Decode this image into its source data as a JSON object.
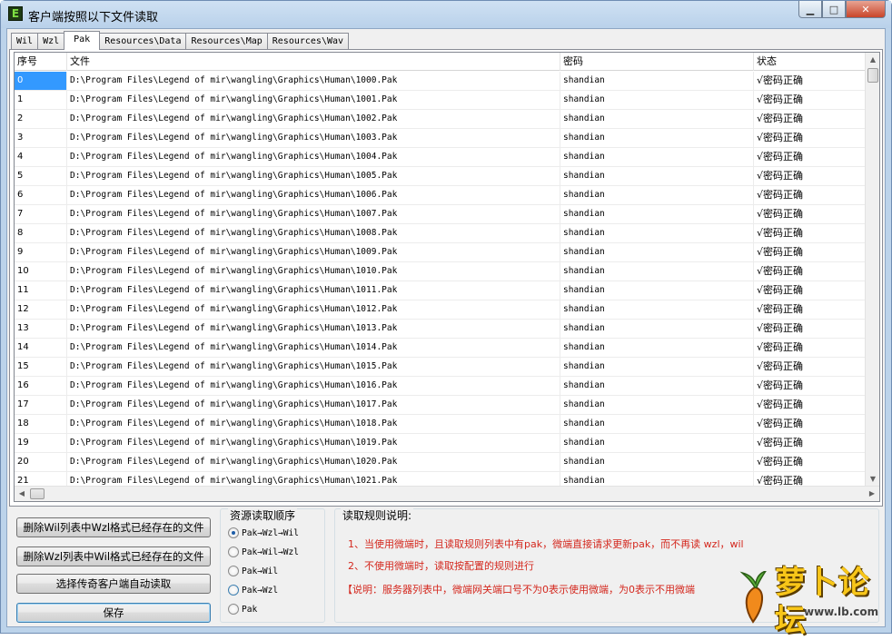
{
  "window": {
    "title": "客户端按照以下文件读取",
    "icon_letter": "E",
    "min_glyph": "▁",
    "max_glyph": "□",
    "close_glyph": "✕"
  },
  "tabs": [
    "Wil",
    "Wzl",
    "Pak",
    "Resources\\Data",
    "Resources\\Map",
    "Resources\\Wav"
  ],
  "active_tab": "Pak",
  "table": {
    "columns": [
      "序号",
      "文件",
      "密码",
      "状态"
    ],
    "rows": [
      {
        "idx": "0",
        "file": "D:\\Program Files\\Legend of mir\\wangling\\Graphics\\Human\\1000.Pak",
        "password": "shandian",
        "status": "√密码正确"
      },
      {
        "idx": "1",
        "file": "D:\\Program Files\\Legend of mir\\wangling\\Graphics\\Human\\1001.Pak",
        "password": "shandian",
        "status": "√密码正确"
      },
      {
        "idx": "2",
        "file": "D:\\Program Files\\Legend of mir\\wangling\\Graphics\\Human\\1002.Pak",
        "password": "shandian",
        "status": "√密码正确"
      },
      {
        "idx": "3",
        "file": "D:\\Program Files\\Legend of mir\\wangling\\Graphics\\Human\\1003.Pak",
        "password": "shandian",
        "status": "√密码正确"
      },
      {
        "idx": "4",
        "file": "D:\\Program Files\\Legend of mir\\wangling\\Graphics\\Human\\1004.Pak",
        "password": "shandian",
        "status": "√密码正确"
      },
      {
        "idx": "5",
        "file": "D:\\Program Files\\Legend of mir\\wangling\\Graphics\\Human\\1005.Pak",
        "password": "shandian",
        "status": "√密码正确"
      },
      {
        "idx": "6",
        "file": "D:\\Program Files\\Legend of mir\\wangling\\Graphics\\Human\\1006.Pak",
        "password": "shandian",
        "status": "√密码正确"
      },
      {
        "idx": "7",
        "file": "D:\\Program Files\\Legend of mir\\wangling\\Graphics\\Human\\1007.Pak",
        "password": "shandian",
        "status": "√密码正确"
      },
      {
        "idx": "8",
        "file": "D:\\Program Files\\Legend of mir\\wangling\\Graphics\\Human\\1008.Pak",
        "password": "shandian",
        "status": "√密码正确"
      },
      {
        "idx": "9",
        "file": "D:\\Program Files\\Legend of mir\\wangling\\Graphics\\Human\\1009.Pak",
        "password": "shandian",
        "status": "√密码正确"
      },
      {
        "idx": "10",
        "file": "D:\\Program Files\\Legend of mir\\wangling\\Graphics\\Human\\1010.Pak",
        "password": "shandian",
        "status": "√密码正确"
      },
      {
        "idx": "11",
        "file": "D:\\Program Files\\Legend of mir\\wangling\\Graphics\\Human\\1011.Pak",
        "password": "shandian",
        "status": "√密码正确"
      },
      {
        "idx": "12",
        "file": "D:\\Program Files\\Legend of mir\\wangling\\Graphics\\Human\\1012.Pak",
        "password": "shandian",
        "status": "√密码正确"
      },
      {
        "idx": "13",
        "file": "D:\\Program Files\\Legend of mir\\wangling\\Graphics\\Human\\1013.Pak",
        "password": "shandian",
        "status": "√密码正确"
      },
      {
        "idx": "14",
        "file": "D:\\Program Files\\Legend of mir\\wangling\\Graphics\\Human\\1014.Pak",
        "password": "shandian",
        "status": "√密码正确"
      },
      {
        "idx": "15",
        "file": "D:\\Program Files\\Legend of mir\\wangling\\Graphics\\Human\\1015.Pak",
        "password": "shandian",
        "status": "√密码正确"
      },
      {
        "idx": "16",
        "file": "D:\\Program Files\\Legend of mir\\wangling\\Graphics\\Human\\1016.Pak",
        "password": "shandian",
        "status": "√密码正确"
      },
      {
        "idx": "17",
        "file": "D:\\Program Files\\Legend of mir\\wangling\\Graphics\\Human\\1017.Pak",
        "password": "shandian",
        "status": "√密码正确"
      },
      {
        "idx": "18",
        "file": "D:\\Program Files\\Legend of mir\\wangling\\Graphics\\Human\\1018.Pak",
        "password": "shandian",
        "status": "√密码正确"
      },
      {
        "idx": "19",
        "file": "D:\\Program Files\\Legend of mir\\wangling\\Graphics\\Human\\1019.Pak",
        "password": "shandian",
        "status": "√密码正确"
      },
      {
        "idx": "20",
        "file": "D:\\Program Files\\Legend of mir\\wangling\\Graphics\\Human\\1020.Pak",
        "password": "shandian",
        "status": "√密码正确"
      },
      {
        "idx": "21",
        "file": "D:\\Program Files\\Legend of mir\\wangling\\Graphics\\Human\\1021.Pak",
        "password": "shandian",
        "status": "√密码正确"
      }
    ],
    "selected_index": 0
  },
  "buttons": {
    "delete_wil": "删除Wil列表中Wzl格式已经存在的文件",
    "delete_wzl": "删除Wzl列表中Wil格式已经存在的文件",
    "auto_read": "选择传奇客户端自动读取",
    "save": "保存"
  },
  "read_order": {
    "title": "资源读取顺序",
    "options": [
      "Pak→Wzl→Wil",
      "Pak→Wil→Wzl",
      "Pak→Wil",
      "Pak→Wzl",
      "Pak"
    ],
    "selected": 0
  },
  "rules": {
    "title": "读取规则说明:",
    "line1": "1、当使用微端时，且读取规则列表中有pak，微端直接请求更新pak，而不再读 wzl，wil",
    "line2": "2、不使用微端时，读取按配置的规则进行",
    "line3": "【说明：服务器列表中，微端网关端口号不为0表示使用微端，为0表示不用微端"
  },
  "watermark": {
    "text": "萝卜论坛",
    "url": "www.lb.com"
  },
  "colors": {
    "selection": "#3399ff",
    "rule_text": "#d4281e",
    "title_bar": "#bcd3ea"
  }
}
